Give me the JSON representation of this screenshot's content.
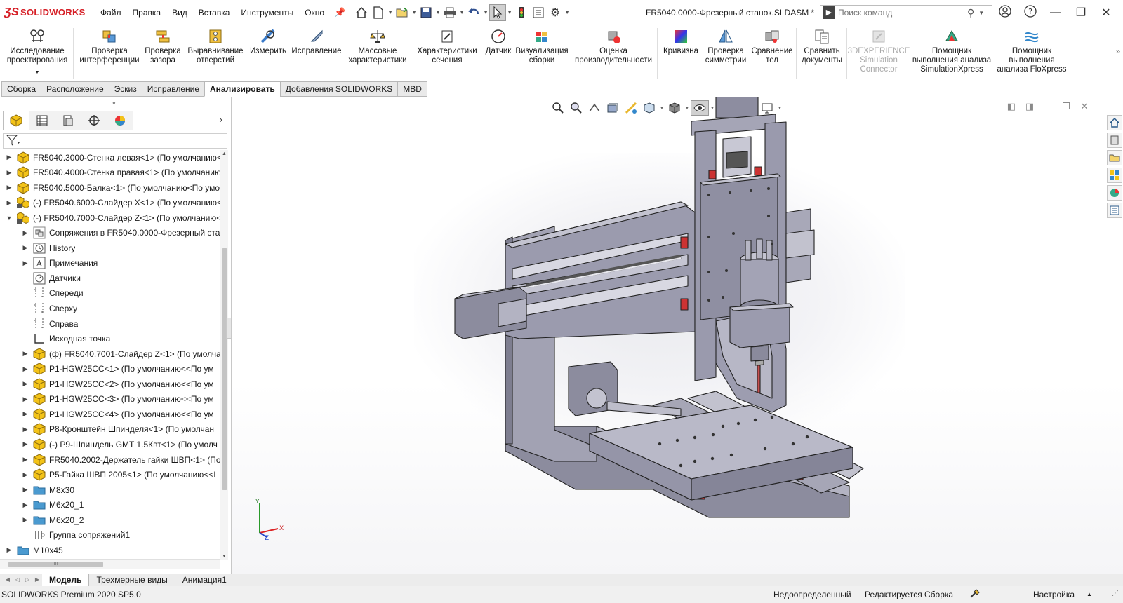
{
  "app": {
    "brand": "SOLIDWORKS",
    "menu": [
      "Файл",
      "Правка",
      "Вид",
      "Вставка",
      "Инструменты",
      "Окно"
    ],
    "document_title": "FR5040.0000-Фрезерный станок.SLDASM *",
    "search_placeholder": "Поиск команд"
  },
  "ribbon": {
    "buttons": [
      {
        "label": "Исследование проектирования",
        "icon": "design-study-icon"
      },
      {
        "label": "Проверка интерференции",
        "icon": "interference-icon"
      },
      {
        "label": "Проверка зазора",
        "icon": "clearance-icon"
      },
      {
        "label": "Выравнивание отверстий",
        "icon": "hole-alignment-icon"
      },
      {
        "label": "Измерить",
        "icon": "measure-icon"
      },
      {
        "label": "Исправление",
        "icon": "fix-icon"
      },
      {
        "label": "Массовые характеристики",
        "icon": "mass-properties-icon"
      },
      {
        "label": "Характеристики сечения",
        "icon": "section-properties-icon"
      },
      {
        "label": "Датчик",
        "icon": "sensor-icon"
      },
      {
        "label": "Визуализация сборки",
        "icon": "assembly-visualization-icon"
      },
      {
        "label": "Оценка производительности",
        "icon": "performance-icon"
      },
      {
        "label": "Кривизна",
        "icon": "curvature-icon"
      },
      {
        "label": "Проверка симметрии",
        "icon": "symmetry-icon"
      },
      {
        "label": "Сравнение тел",
        "icon": "compare-bodies-icon"
      },
      {
        "label": "Сравнить документы",
        "icon": "compare-documents-icon"
      },
      {
        "label": "3DEXPERIENCE Simulation Connector",
        "icon": "simulation-connector-icon"
      },
      {
        "label": "Помощник выполнения анализа SimulationXpress",
        "icon": "simulationxpress-icon"
      },
      {
        "label": "Помощник выполнения анализа FloXpress",
        "icon": "floxpress-icon"
      }
    ]
  },
  "tabs": [
    "Сборка",
    "Расположение",
    "Эскиз",
    "Исправление",
    "Анализировать",
    "Добавления SOLIDWORKS",
    "MBD"
  ],
  "active_tab": "Анализировать",
  "tree": [
    {
      "label": "FR5040.3000-Стенка левая<1> (По умолчанию<",
      "level": 0,
      "icon": "part-icon"
    },
    {
      "label": "FR5040.4000-Стенка правая<1> (По умолчанию",
      "level": 0,
      "icon": "part-icon"
    },
    {
      "label": "FR5040.5000-Балка<1> (По умолчанию<По умо",
      "level": 0,
      "icon": "part-icon"
    },
    {
      "label": "(-) FR5040.6000-Слайдер X<1> (По умолчанию<",
      "level": 0,
      "icon": "subassembly-icon"
    },
    {
      "label": "(-) FR5040.7000-Слайдер Z<1> (По умолчанию<",
      "level": 0,
      "icon": "subassembly-icon",
      "expanded": true
    },
    {
      "label": "Сопряжения в FR5040.0000-Фрезерный стан",
      "level": 1,
      "icon": "mates-icon"
    },
    {
      "label": "History",
      "level": 1,
      "icon": "history-icon"
    },
    {
      "label": "Примечания",
      "level": 1,
      "icon": "annotations-icon"
    },
    {
      "label": "Датчики",
      "level": 1,
      "icon": "sensors-icon",
      "leaf": true
    },
    {
      "label": "Спереди",
      "level": 1,
      "icon": "plane-icon",
      "leaf": true
    },
    {
      "label": "Сверху",
      "level": 1,
      "icon": "plane-icon",
      "leaf": true
    },
    {
      "label": "Справа",
      "level": 1,
      "icon": "plane-icon",
      "leaf": true
    },
    {
      "label": "Исходная точка",
      "level": 1,
      "icon": "origin-icon",
      "leaf": true
    },
    {
      "label": "(ф) FR5040.7001-Слайдер Z<1> (По умолчан",
      "level": 1,
      "icon": "part-icon"
    },
    {
      "label": "P1-HGW25CC<1> (По умолчанию<<По ум",
      "level": 1,
      "icon": "part-icon"
    },
    {
      "label": "P1-HGW25CC<2> (По умолчанию<<По ум",
      "level": 1,
      "icon": "part-icon"
    },
    {
      "label": "P1-HGW25CC<3> (По умолчанию<<По ум",
      "level": 1,
      "icon": "part-icon"
    },
    {
      "label": "P1-HGW25CC<4> (По умолчанию<<По ум",
      "level": 1,
      "icon": "part-icon"
    },
    {
      "label": "P8-Кронштейн Шпинделя<1> (По умолчан",
      "level": 1,
      "icon": "part-icon"
    },
    {
      "label": "(-) P9-Шпиндель GMT 1.5Квт<1> (По умолч",
      "level": 1,
      "icon": "part-icon"
    },
    {
      "label": "FR5040.2002-Держатель гайки ШВП<1> (По",
      "level": 1,
      "icon": "part-icon"
    },
    {
      "label": "P5-Гайка ШВП 2005<1> (По умолчанию<<I",
      "level": 1,
      "icon": "part-icon"
    },
    {
      "label": "M8x30",
      "level": 1,
      "icon": "folder-icon"
    },
    {
      "label": "M6x20_1",
      "level": 1,
      "icon": "folder-icon"
    },
    {
      "label": "M6x20_2",
      "level": 1,
      "icon": "folder-icon"
    },
    {
      "label": "Группа сопряжений1",
      "level": 1,
      "icon": "mate-group-icon",
      "leaf": true
    },
    {
      "label": "M10x45",
      "level": 0,
      "icon": "folder-icon"
    }
  ],
  "bottom_tabs": [
    "Модель",
    "Трехмерные виды",
    "Анимация1"
  ],
  "active_bottom_tab": "Модель",
  "status": {
    "version": "SOLIDWORKS Premium 2020 SP5.0",
    "definition": "Недоопределенный",
    "mode": "Редактируется Сборка",
    "custom": "Настройка"
  },
  "triad": {
    "x": "X",
    "y": "Y",
    "z": "Z"
  },
  "colors": {
    "brand_red": "#d61f26",
    "part_yellow": "#f3c318",
    "model_gray": "#9a9aaa"
  }
}
